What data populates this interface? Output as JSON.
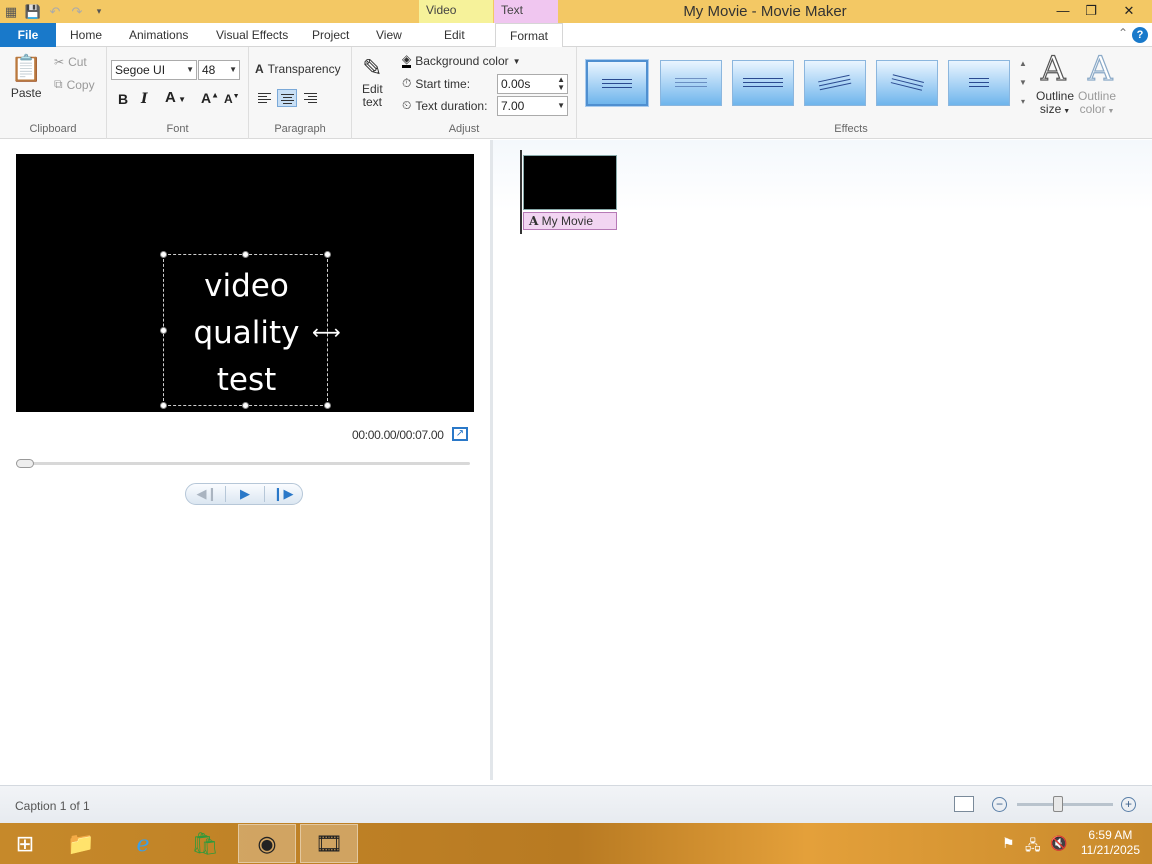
{
  "titlebar": {
    "title": "My Movie - Movie Maker",
    "context_video": "Video Tools",
    "context_text": "Text Tools",
    "minimize": "—",
    "restore": "❐",
    "close": "✕"
  },
  "tabs": {
    "file": "File",
    "home": "Home",
    "animations": "Animations",
    "visual_effects": "Visual Effects",
    "project": "Project",
    "view": "View",
    "edit": "Edit",
    "format": "Format"
  },
  "clipboard": {
    "paste": "Paste",
    "cut": "Cut",
    "copy": "Copy",
    "label": "Clipboard"
  },
  "font": {
    "family": "Segoe UI",
    "size": "48",
    "bold": "B",
    "italic": "I",
    "color": "A",
    "grow": "A",
    "shrink": "A",
    "label": "Font"
  },
  "paragraph": {
    "transparency": "Transparency",
    "label": "Paragraph"
  },
  "adjust": {
    "edit_text_line1": "Edit",
    "edit_text_line2": "text",
    "background_color": "Background color",
    "start_time_label": "Start time:",
    "start_time_value": "0.00s",
    "text_duration_label": "Text duration:",
    "text_duration_value": "7.00",
    "label": "Adjust"
  },
  "effects": {
    "label": "Effects",
    "outline_size_line1": "Outline",
    "outline_size_line2": "size",
    "outline_color_line1": "Outline",
    "outline_color_line2": "color"
  },
  "preview": {
    "caption_line1": "video",
    "caption_line2": "quality",
    "caption_line3": "test",
    "timecode": "00:00.00/00:07.00"
  },
  "storyboard": {
    "caption_clip": "My Movie"
  },
  "status": {
    "text": "Caption 1 of 1",
    "zoom_out": "−",
    "zoom_in": "+",
    "zoom_level": 0.42
  },
  "clock": {
    "time": "6:59 AM",
    "date": "11/21/2025"
  },
  "colors": {
    "titlebar": "#f3c864",
    "file_tab": "#1979ca",
    "text_tools": "#f0c6f0",
    "video_tools": "#f6f29a"
  }
}
